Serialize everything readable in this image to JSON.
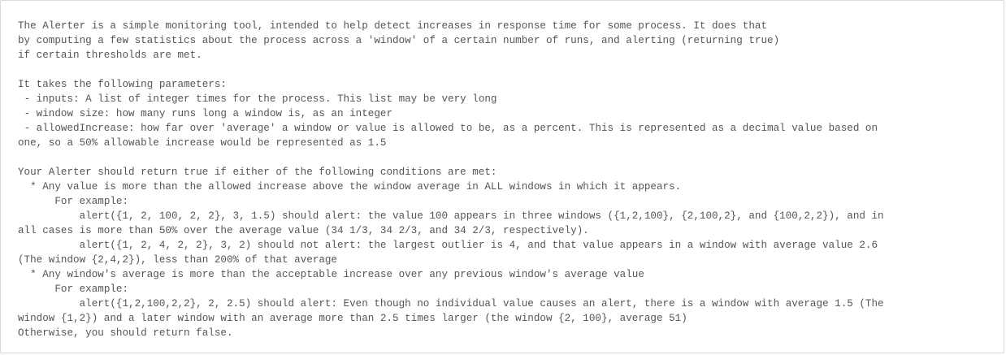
{
  "description": {
    "lines": [
      "The Alerter is a simple monitoring tool, intended to help detect increases in response time for some process. It does that",
      "by computing a few statistics about the process across a 'window' of a certain number of runs, and alerting (returning true)",
      "if certain thresholds are met.",
      "",
      "It takes the following parameters:",
      " - inputs: A list of integer times for the process. This list may be very long",
      " - window size: how many runs long a window is, as an integer",
      " - allowedIncrease: how far over 'average' a window or value is allowed to be, as a percent. This is represented as a decimal value based on",
      "one, so a 50% allowable increase would be represented as 1.5",
      "",
      "Your Alerter should return true if either of the following conditions are met:",
      "  * Any value is more than the allowed increase above the window average in ALL windows in which it appears.",
      "      For example:",
      "          alert({1, 2, 100, 2, 2}, 3, 1.5) should alert: the value 100 appears in three windows ({1,2,100}, {2,100,2}, and {100,2,2}), and in",
      "all cases is more than 50% over the average value (34 1/3, 34 2/3, and 34 2/3, respectively).",
      "          alert({1, 2, 4, 2, 2}, 3, 2) should not alert: the largest outlier is 4, and that value appears in a window with average value 2.6",
      "(The window {2,4,2}), less than 200% of that average",
      "  * Any window's average is more than the acceptable increase over any previous window's average value",
      "      For example:",
      "          alert({1,2,100,2,2}, 2, 2.5) should alert: Even though no individual value causes an alert, there is a window with average 1.5 (The",
      "window {1,2}) and a later window with an average more than 2.5 times larger (the window {2, 100}, average 51)",
      "Otherwise, you should return false."
    ]
  }
}
